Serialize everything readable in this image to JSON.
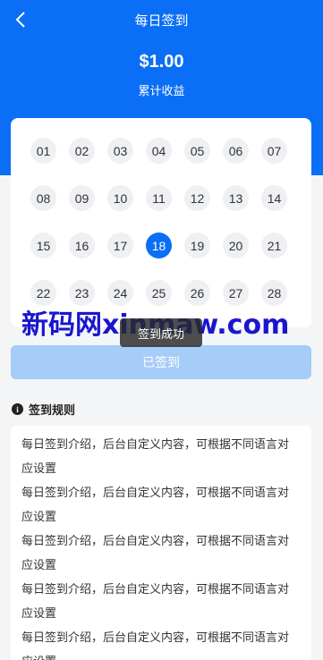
{
  "header": {
    "title": "每日签到",
    "amount": "$1.00",
    "amount_label": "累计收益"
  },
  "calendar": {
    "days": [
      "01",
      "02",
      "03",
      "04",
      "05",
      "06",
      "07",
      "08",
      "09",
      "10",
      "11",
      "12",
      "13",
      "14",
      "15",
      "16",
      "17",
      "18",
      "19",
      "20",
      "21",
      "22",
      "23",
      "24",
      "25",
      "26",
      "27",
      "28"
    ],
    "selected_day": "18"
  },
  "toast": {
    "text": "签到成功"
  },
  "signin_button": {
    "label": "已签到"
  },
  "watermark": {
    "text": "新码网xinmaw.com"
  },
  "rules": {
    "title": "签到规则",
    "info_icon": "i",
    "lines": [
      "每日签到介绍，后台自定义内容，可根据不同语言对",
      "应设置",
      "每日签到介绍，后台自定义内容，可根据不同语言对",
      "应设置",
      "每日签到介绍，后台自定义内容，可根据不同语言对",
      "应设置",
      "每日签到介绍，后台自定义内容，可根据不同语言对",
      "应设置",
      "每日签到介绍，后台自定义内容，可根据不同语言对",
      "应设置"
    ]
  },
  "colors": {
    "primary": "#0b6ef6",
    "button_disabled": "#a6ccf8",
    "watermark": "#1a16d0"
  },
  "icons": {
    "back": "chevron-left-icon",
    "info": "info-icon"
  }
}
